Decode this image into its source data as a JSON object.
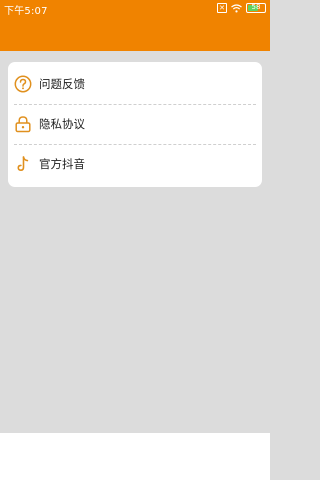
{
  "status_bar": {
    "time": "下午5:07",
    "battery_level": "58",
    "icons": [
      "sim-x-icon",
      "wifi-icon",
      "battery-icon"
    ]
  },
  "theme": {
    "accent": "#f08300",
    "background": "#dcdcdc"
  },
  "menu": {
    "items": [
      {
        "label": "问题反馈",
        "icon": "question-circle-icon"
      },
      {
        "label": "隐私协议",
        "icon": "lock-icon"
      },
      {
        "label": "官方抖音",
        "icon": "tiktok-icon"
      }
    ]
  }
}
